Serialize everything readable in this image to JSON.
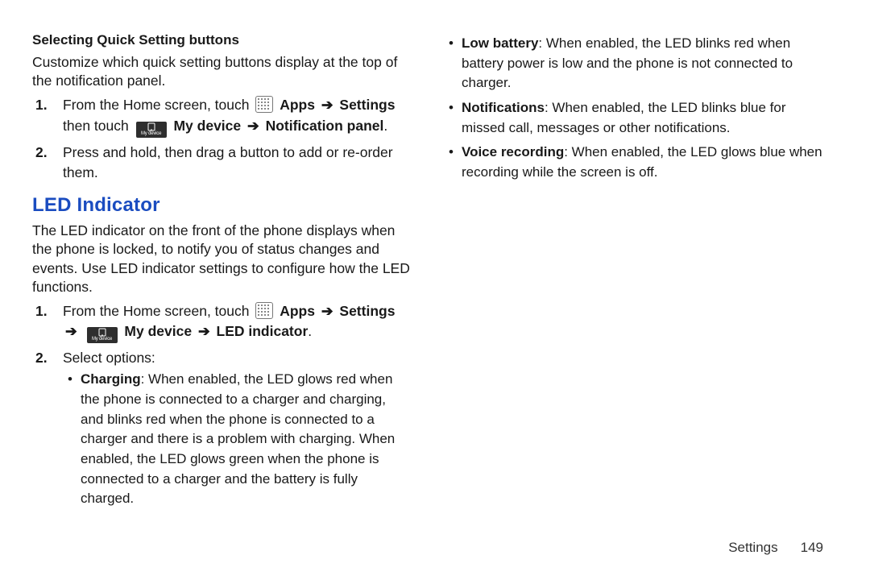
{
  "left": {
    "subhead": "Selecting Quick Setting buttons",
    "intro": "Customize which quick setting buttons display at the top of the notification panel.",
    "step1_a": "From the Home screen, touch ",
    "step1_b": "Apps",
    "step1_c": "Settings",
    "step1_d": " then touch ",
    "step1_e": "My device",
    "step1_f": "Notification panel",
    "step2": "Press and hold, then drag a button to add or re-order them.",
    "h2": "LED Indicator",
    "ledintro": "The LED indicator on the front of the phone displays when the phone is locked, to notify you of status changes and events. Use LED indicator settings to configure how the LED functions.",
    "led_step1_a": "From the Home screen, touch ",
    "led_step1_b": "Apps",
    "led_step1_c": "Settings",
    "led_step1_d": "My device",
    "led_step1_e": "LED indicator",
    "led_step2": "Select options:",
    "opt_charging_h": "Charging",
    "opt_charging_t": ": When enabled, the LED glows red when the phone is connected to a charger and charging, and blinks red when the phone is connected to a charger and there is a problem with charging. When enabled, the LED glows green when the phone is connected to a charger and the battery is fully charged."
  },
  "right": {
    "opt_low_h": "Low battery",
    "opt_low_t": ": When enabled, the LED blinks red when battery power is low and the phone is not connected to charger.",
    "opt_notif_h": "Notifications",
    "opt_notif_t": ": When enabled, the LED blinks blue for missed call, messages or other notifications.",
    "opt_voice_h": "Voice recording",
    "opt_voice_t": ": When enabled, the LED glows blue when recording while the screen is off."
  },
  "footer": {
    "section": "Settings",
    "page": "149"
  },
  "glyphs": {
    "arrow": "➔",
    "mydev_label": "My device"
  }
}
